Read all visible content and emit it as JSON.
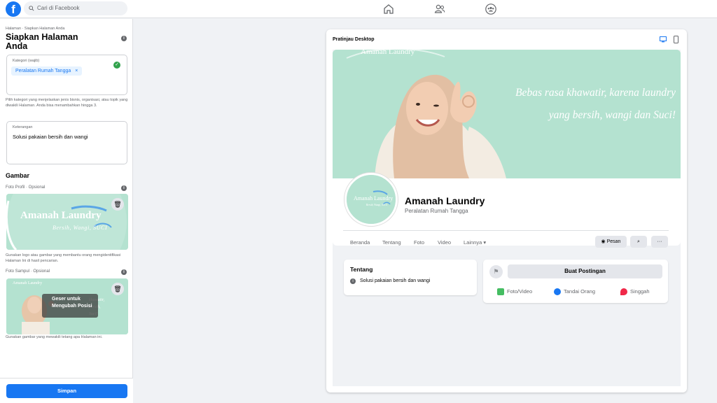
{
  "topbar": {
    "logo": "f",
    "search_placeholder": "Cari di Facebook",
    "icons": [
      "home-icon",
      "friends-icon",
      "groups-icon"
    ]
  },
  "left_panel": {
    "breadcrumb": "Halaman · Siapkan Halaman Anda",
    "title": "Siapkan Halaman Anda",
    "category": {
      "label": "Kategori (wajib)",
      "chip": "Peralatan Rumah Tangga",
      "chip_remove": "×"
    },
    "category_help": "Pilih kategori yang menjelaskan jenis bisnis, organisasi, atau topik yang diwakili Halaman. Anda bisa menambahkan hingga 3.",
    "description": {
      "label": "Keterangan",
      "value": "Solusi pakaian bersih dan wangi"
    },
    "images_section": "Gambar",
    "profile_photo_label": "Foto Profil · Opsional",
    "profile_help": "Gunakan logo atau gambar yang membantu orang mengidentifikasi Halaman Ini di hasil pencarian.",
    "cover_photo_label": "Foto Sampul · Opsional",
    "cover_drag_hint": "Geser untuk Mengubah Posisi",
    "cover_help": "Gunakan gambar yang mewakili tetang apa Halaman ini.",
    "save_button": "Simpan"
  },
  "preview": {
    "title": "Pratinjau Desktop",
    "cover_logo": "Amanah Laundry",
    "cover_text": "Bebas rasa khawatir, karena laundry yang bersih, wangi dan Suci!",
    "logo_text": "Amanah Laundry",
    "logo_tagline": "Bersih, Wangi, SUCI",
    "page_name": "Amanah Laundry",
    "page_category": "Peralatan Rumah Tangga",
    "tabs": [
      "Beranda",
      "Tentang",
      "Foto",
      "Video",
      "Lainnya ▾"
    ],
    "message_button": "Pesan",
    "about_title": "Tentang",
    "about_text": "Solusi pakaian bersih dan wangi",
    "create_post": "Buat Postingan",
    "actions": [
      "Foto/Video",
      "Tandai Orang",
      "Singgah"
    ]
  },
  "colors": {
    "brand": "#1877f2",
    "mint": "#b4e2d0",
    "success": "#31a24c"
  }
}
